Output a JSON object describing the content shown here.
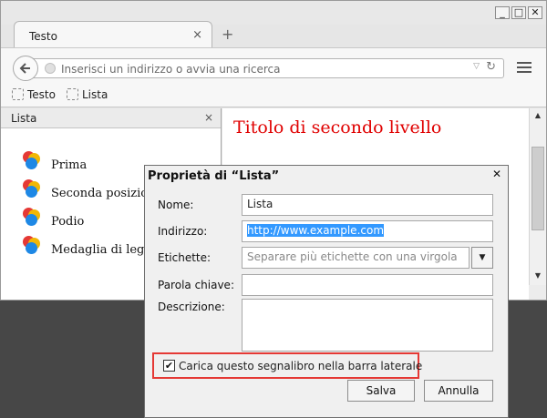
{
  "window": {
    "minimize": "_",
    "maximize": "□",
    "close": "✕"
  },
  "tab": {
    "label": "Testo",
    "close": "×",
    "new_tab": "+"
  },
  "nav": {
    "back_icon": "arrow-left-icon",
    "url_placeholder": "Inserisci un indirizzo o avvia una ricerca",
    "dropdown": "▽",
    "reload": "↻"
  },
  "bookmarks": [
    {
      "label": "Testo"
    },
    {
      "label": "Lista"
    }
  ],
  "sidebar": {
    "title": "Lista",
    "close": "×",
    "items": [
      {
        "label": "Prima"
      },
      {
        "label": "Seconda posizione"
      },
      {
        "label": "Podio"
      },
      {
        "label": "Medaglia di legno"
      }
    ]
  },
  "page": {
    "heading": "Titolo di secondo livello"
  },
  "scrollbar": {
    "up": "▲",
    "down": "▼"
  },
  "dialog": {
    "title": "Proprietà di “Lista”",
    "close": "✕",
    "name_label": "Nome:",
    "name_value": "Lista",
    "address_label": "Indirizzo:",
    "address_value": "http://www.example.com",
    "tags_label": "Etichette:",
    "tags_placeholder": "Separare più etichette con una virgola",
    "tags_button": "▼",
    "keyword_label": "Parola chiave:",
    "keyword_value": "",
    "description_label": "Descrizione:",
    "sidebar_checkbox_label": "Carica questo segnalibro nella barra laterale",
    "sidebar_checkbox_checked": true,
    "check_mark": "✔",
    "save_label": "Salva",
    "cancel_label": "Annulla"
  },
  "colors": {
    "heading": "#e00000",
    "highlight_border": "#e53935",
    "selection": "#3399ff",
    "medal_red": "#e53935",
    "medal_yellow": "#f2b705",
    "medal_blue": "#1e88e5"
  }
}
